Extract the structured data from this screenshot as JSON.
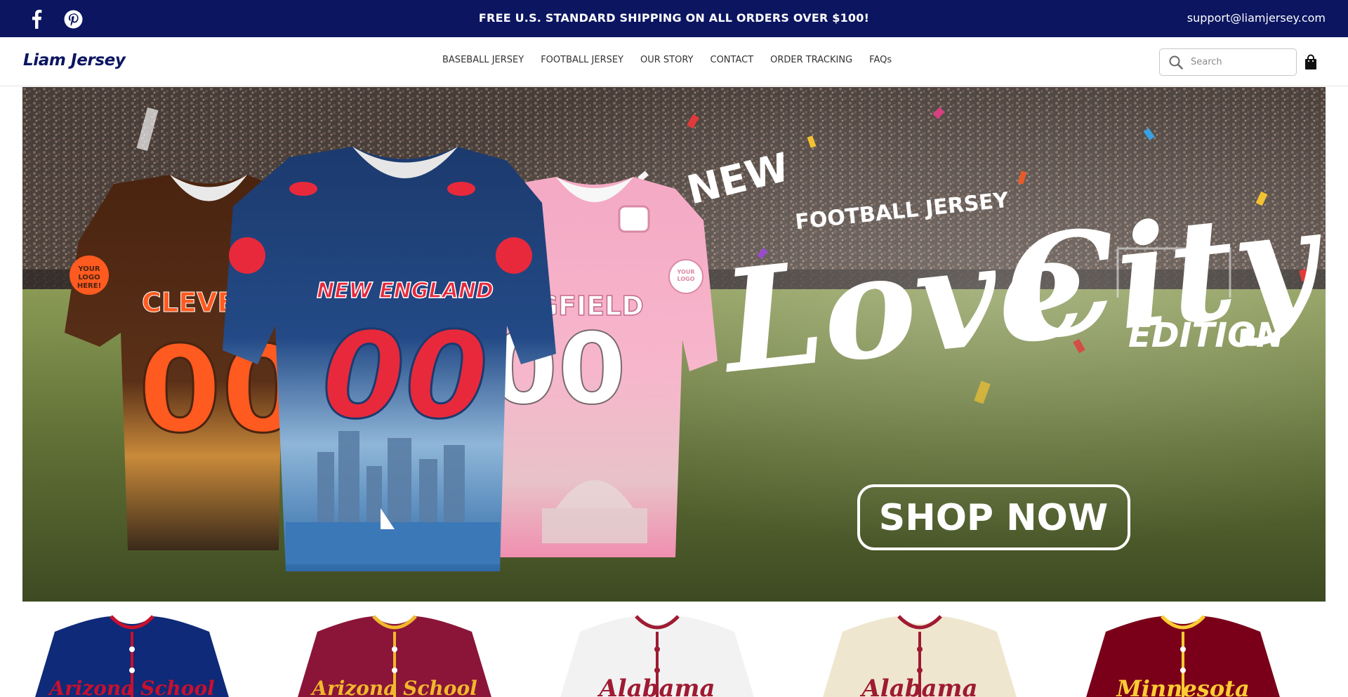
{
  "topbar": {
    "promo": "FREE U.S. STANDARD SHIPPING ON ALL ORDERS OVER $100!",
    "email": "support@liamjersey.com",
    "social": [
      "facebook-icon",
      "pinterest-icon"
    ],
    "bg_color": "#0b1560"
  },
  "header": {
    "logo": "Liam Jersey",
    "nav": [
      {
        "label": "BASEBALL JERSEY"
      },
      {
        "label": "FOOTBALL JERSEY"
      },
      {
        "label": "OUR STORY"
      },
      {
        "label": "CONTACT"
      },
      {
        "label": "ORDER TRACKING"
      },
      {
        "label": "FAQs"
      }
    ],
    "search_placeholder": "Search",
    "cart_icon": "shopping-bag-icon"
  },
  "hero": {
    "headline_new": "NEW",
    "headline_sub": "FOOTBALL JERSEY",
    "headline_love": "Love",
    "headline_city": "City",
    "headline_edition": "EDITION",
    "cta": "SHOP NOW",
    "jerseys": [
      {
        "team": "CLEVEL",
        "number": "00",
        "color": "#4a2410",
        "accent": "#ff5a1f"
      },
      {
        "team": "NEW ENGLAND",
        "number": "00",
        "color": "#1c3a6e",
        "accent": "#e8293c"
      },
      {
        "team": "NGFIELD",
        "number": "00",
        "color": "#f4a9c4",
        "accent": "#ffffff"
      }
    ],
    "logo_badge": "YOUR LOGO HERE!"
  },
  "products": [
    {
      "script": "Arizona School",
      "base": "#0e2a78",
      "trim": "#c8102e"
    },
    {
      "script": "Arizona School",
      "base": "#8a1538",
      "trim": "#f1b82d"
    },
    {
      "script": "Alabama",
      "base": "#f2f2f2",
      "trim": "#9e1b32"
    },
    {
      "script": "Alabama",
      "base": "#efe6cf",
      "trim": "#9e1b32"
    },
    {
      "script": "Minnesota",
      "base": "#7a0019",
      "trim": "#ffcc33"
    }
  ]
}
